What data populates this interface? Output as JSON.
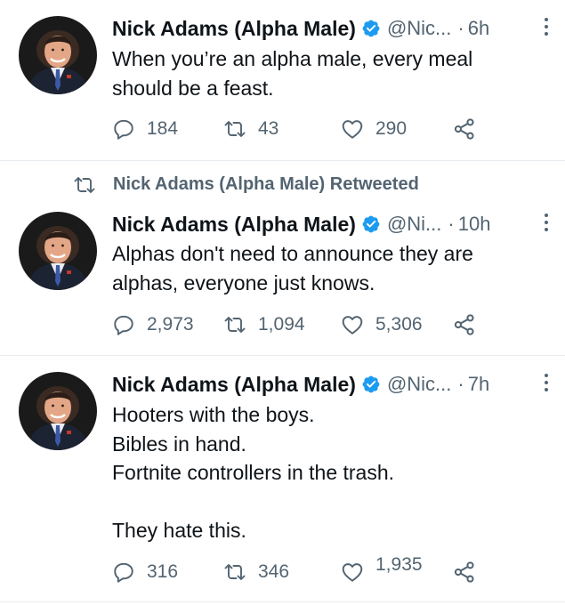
{
  "colors": {
    "verified_badge": "#1d9bf0",
    "secondary_text": "#536471",
    "primary_text": "#0f1419",
    "separator": "#e6ecf0"
  },
  "icons": {
    "reply": "reply-icon",
    "retweet": "retweet-icon",
    "like": "heart-icon",
    "share": "share-icon",
    "more": "more-options-icon",
    "verified": "verified-badge-icon"
  },
  "tweets": [
    {
      "author_name": "Nick Adams (Alpha Male)",
      "handle": "@Nic...",
      "dot": "·",
      "time": "6h",
      "lines": [
        "When you’re an alpha male, every meal",
        "should be a feast."
      ],
      "replies": "184",
      "retweets": "43",
      "likes": "290"
    },
    {
      "retweet_label": "Nick Adams (Alpha Male) Retweeted",
      "author_name": "Nick Adams (Alpha Male)",
      "handle": "@Ni...",
      "dot": "·",
      "time": "10h",
      "lines": [
        "Alphas don't need to announce they are",
        "alphas, everyone just knows."
      ],
      "replies": "2,973",
      "retweets": "1,094",
      "likes": "5,306"
    },
    {
      "author_name": "Nick Adams (Alpha Male)",
      "handle": "@Nic...",
      "dot": "·",
      "time": "7h",
      "lines": [
        "Hooters with the boys.",
        "Bibles in hand.",
        "Fortnite controllers in the trash.",
        "",
        "They hate this."
      ],
      "replies": "316",
      "retweets": "346",
      "likes": "1,935"
    }
  ]
}
